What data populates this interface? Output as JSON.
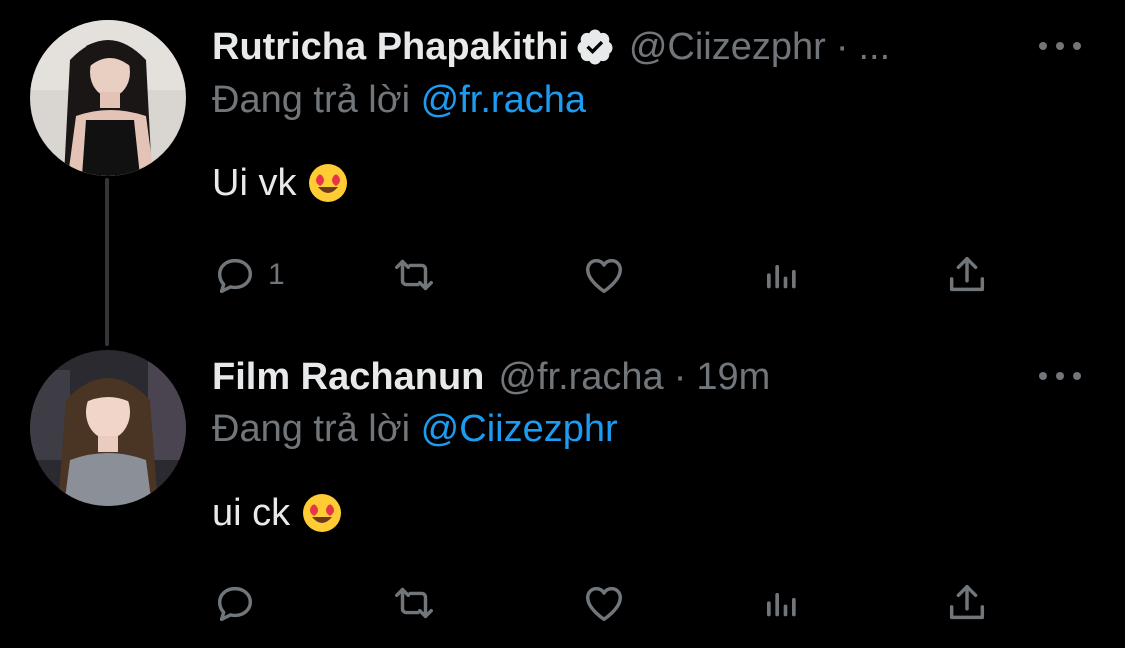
{
  "tweets": [
    {
      "name": "Rutricha Phapakithi",
      "verified": true,
      "handle": "@Ciizezphr",
      "dot": "·",
      "time": "...",
      "replying_prefix": "Đang trả lời",
      "replying_to": "@fr.racha",
      "text": "Ui vk",
      "emoji": "smiling-face-with-heart-eyes",
      "reply_count": "1"
    },
    {
      "name": "Film Rachanun",
      "verified": false,
      "handle": "@fr.racha",
      "dot": "·",
      "time": "19m",
      "replying_prefix": "Đang trả lời",
      "replying_to": "@Ciizezphr",
      "text": "ui ck",
      "emoji": "smiling-face-with-heart-eyes",
      "reply_count": ""
    }
  ],
  "colors": {
    "background": "#000000",
    "text": "#e7e9ea",
    "muted": "#71767b",
    "accent": "#1d9bf0",
    "thread_line": "#333639"
  }
}
